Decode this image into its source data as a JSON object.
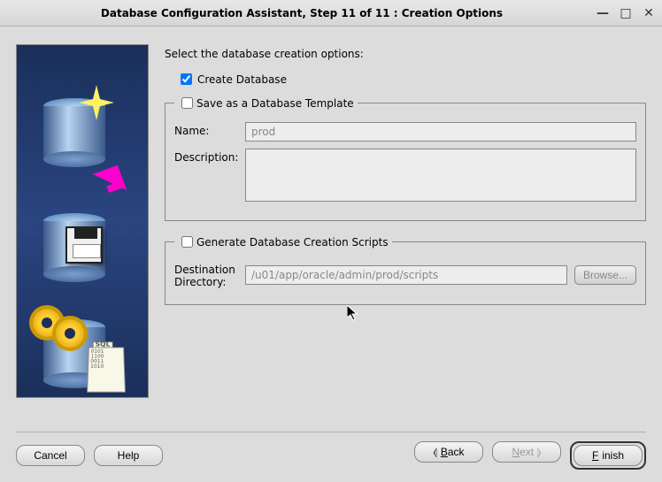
{
  "window": {
    "title": "Database Configuration Assistant, Step 11 of 11 : Creation Options"
  },
  "main": {
    "intro": "Select the database creation options:",
    "create_db": {
      "label": "Create Database",
      "checked": true
    },
    "save_template": {
      "legend": "Save as a Database Template",
      "checked": false,
      "name_label": "Name:",
      "name_value": "prod",
      "desc_label": "Description:",
      "desc_value": ""
    },
    "gen_scripts": {
      "legend": "Generate Database Creation Scripts",
      "checked": false,
      "dest_label": "Destination\nDirectory:",
      "dest_value": "/u01/app/oracle/admin/prod/scripts",
      "browse_label": "Browse..."
    }
  },
  "buttons": {
    "cancel": "Cancel",
    "help": "Help",
    "back": "Back",
    "next": "Next",
    "finish": "Finish"
  }
}
